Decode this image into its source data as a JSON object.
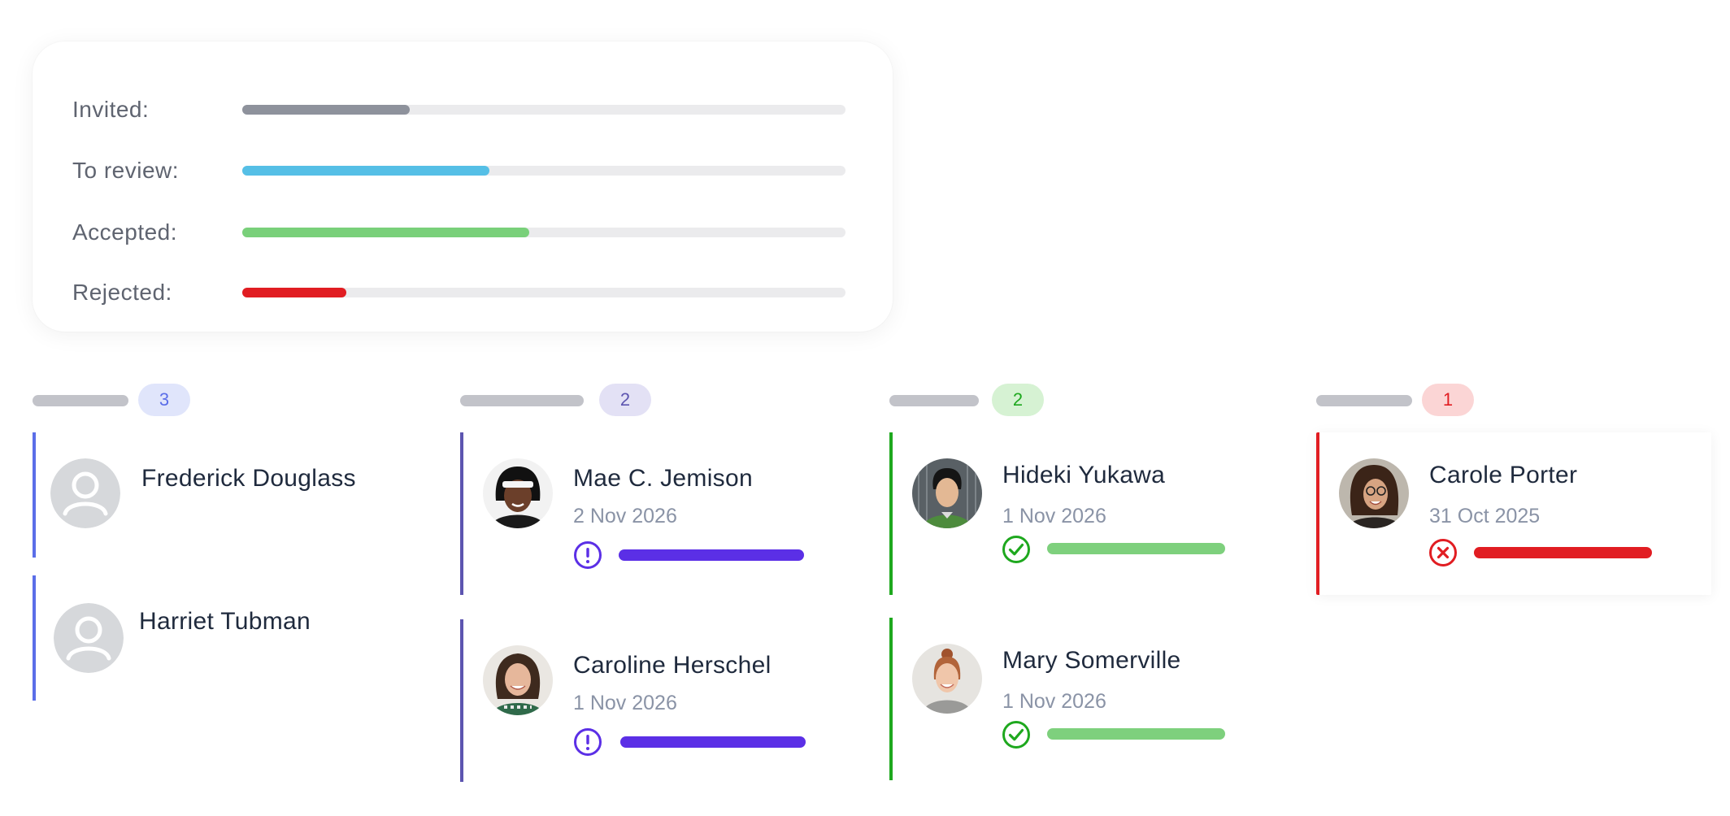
{
  "summary": {
    "rows": [
      {
        "label": "Invited:",
        "progress": 0.277,
        "color": "#8e929c"
      },
      {
        "label": "To review:",
        "progress": 0.41,
        "color": "#55bfe6"
      },
      {
        "label": "Accepted:",
        "progress": 0.476,
        "color": "#79d07a"
      },
      {
        "label": "Rejected:",
        "progress": 0.172,
        "color": "#e11d22"
      }
    ]
  },
  "columns": [
    {
      "count": "3",
      "accent": "#5b6ee8",
      "badge_bg": "#e0e5fb",
      "badge_color": "#5b6ee8",
      "cards": [
        {
          "name": "Frederick Douglass",
          "avatar": "placeholder-avatar"
        },
        {
          "name": "Harriet Tubman",
          "avatar": "placeholder-avatar"
        }
      ]
    },
    {
      "count": "2",
      "accent": "#5d55b0",
      "badge_bg": "#e3e1f5",
      "badge_color": "#5d55b0",
      "cards": [
        {
          "name": "Mae C. Jemison",
          "date": "2 Nov 2026",
          "status_icon": "exclamation-circle-icon",
          "status_color": "#5b2fe6"
        },
        {
          "name": "Caroline Herschel",
          "date": "1 Nov 2026",
          "status_icon": "exclamation-circle-icon",
          "status_color": "#5b2fe6"
        }
      ]
    },
    {
      "count": "2",
      "accent": "#1ea81e",
      "badge_bg": "#d6f2d3",
      "badge_color": "#1ea81e",
      "cards": [
        {
          "name": "Hideki Yukawa",
          "date": "1 Nov 2026",
          "status_icon": "check-circle-icon",
          "status_color": "#1ea81e",
          "bar_color": "#7ed07d"
        },
        {
          "name": "Mary Somerville",
          "date": "1 Nov 2026",
          "status_icon": "check-circle-icon",
          "status_color": "#1ea81e",
          "bar_color": "#7ed07d"
        }
      ]
    },
    {
      "count": "1",
      "accent": "#e11d22",
      "badge_bg": "#fbd5d5",
      "badge_color": "#e11d22",
      "cards": [
        {
          "name": "Carole Porter",
          "date": "31 Oct 2025",
          "status_icon": "x-circle-icon",
          "status_color": "#e11d22",
          "bar_color": "#e11d22"
        }
      ]
    }
  ]
}
